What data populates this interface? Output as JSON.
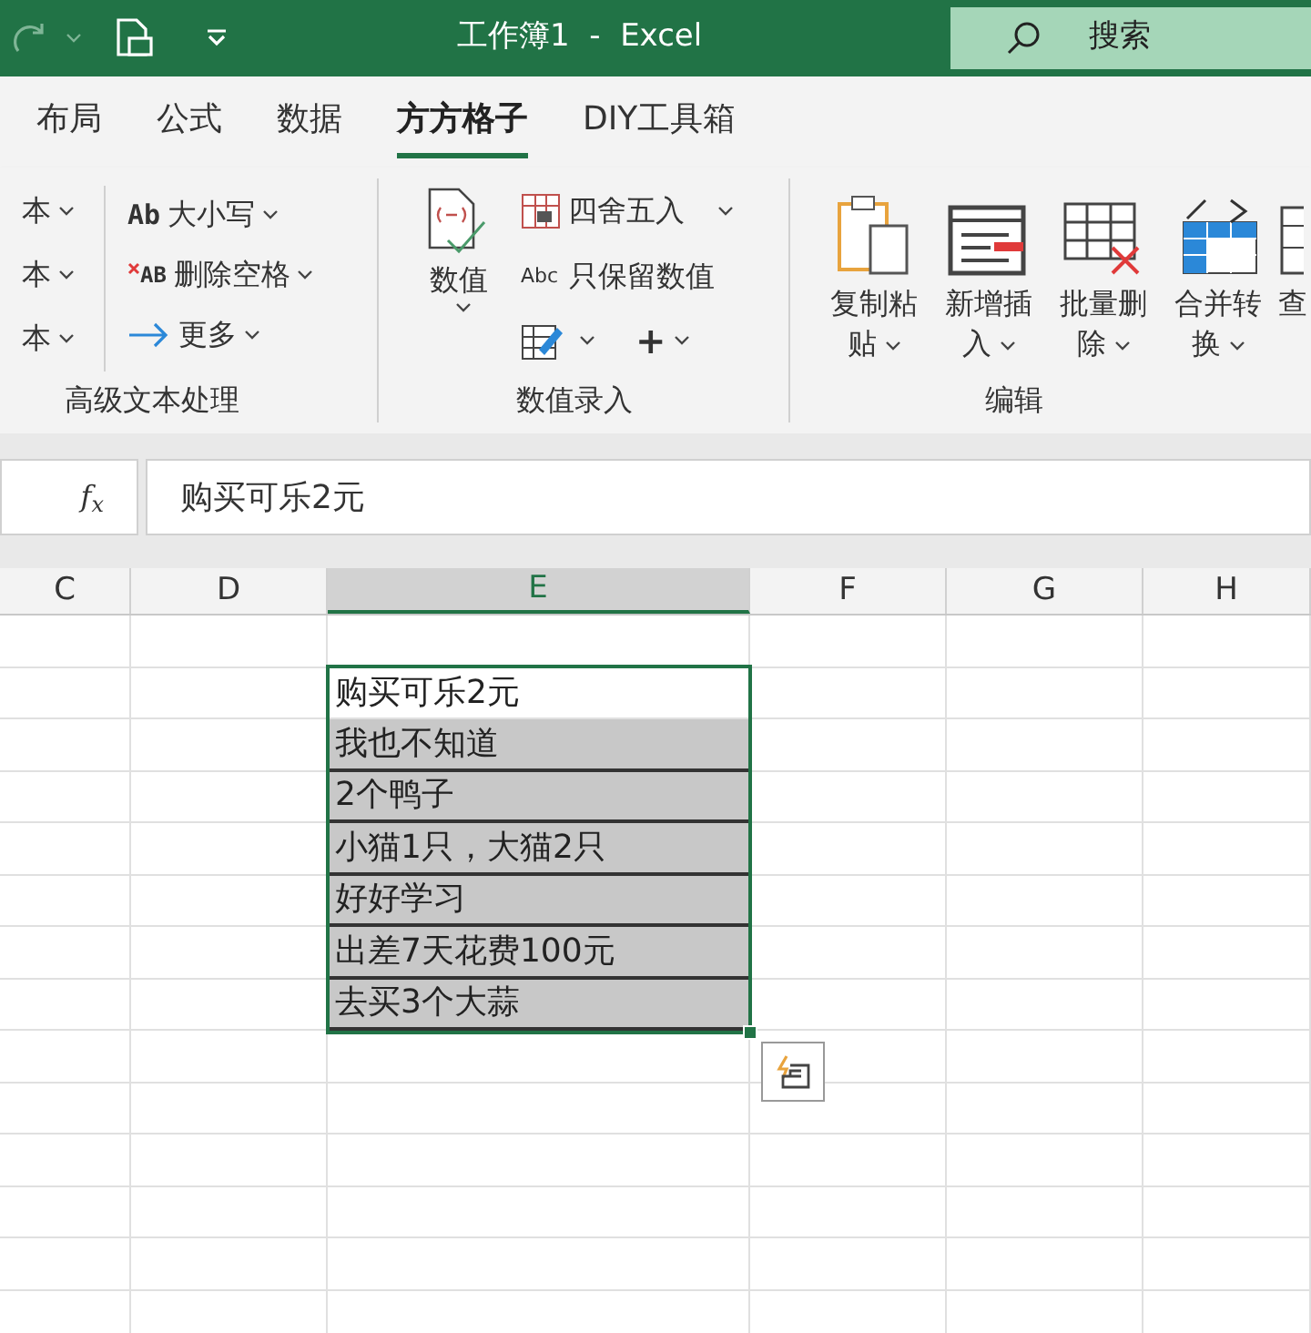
{
  "title_bar": {
    "title": "工作簿1  -  Excel",
    "search_placeholder": "搜索"
  },
  "tabs": [
    {
      "label": "布局",
      "selected": false
    },
    {
      "label": "公式",
      "selected": false
    },
    {
      "label": "数据",
      "selected": false
    },
    {
      "label": "方方格子",
      "selected": true
    },
    {
      "label": "DIY工具箱",
      "selected": false
    }
  ],
  "ribbon": {
    "text_group": {
      "label": "高级文本处理",
      "left_items": [
        "本",
        "本",
        "本"
      ],
      "items": [
        {
          "kind": "case",
          "glyph": "Ab",
          "label": "大小写"
        },
        {
          "kind": "trim",
          "glyph": "AB",
          "label": "删除空格"
        },
        {
          "kind": "more",
          "label": "更多"
        }
      ]
    },
    "number_group": {
      "label": "数值录入",
      "big_button": "数值",
      "items": [
        {
          "kind": "round",
          "label": "四舍五入"
        },
        {
          "kind": "keep",
          "glyph": "Abc",
          "label": "只保留数值"
        },
        {
          "kind": "tools",
          "glyph": "+"
        }
      ]
    },
    "edit_group": {
      "label": "编辑",
      "buttons": [
        {
          "kind": "paste",
          "label": "复制粘贴"
        },
        {
          "kind": "insert",
          "label": "新增插入"
        },
        {
          "kind": "delete",
          "label": "批量删除"
        },
        {
          "kind": "merge",
          "label": "合并转换"
        },
        {
          "kind": "cut",
          "label": "查"
        }
      ]
    }
  },
  "formula_bar": {
    "fx": "f$_{x}$",
    "value": "购买可乐2元"
  },
  "columns": [
    {
      "label": "C",
      "selected": false
    },
    {
      "label": "D",
      "selected": false
    },
    {
      "label": "E",
      "selected": true
    },
    {
      "label": "F",
      "selected": false
    },
    {
      "label": "G",
      "selected": false
    },
    {
      "label": "H",
      "selected": false
    }
  ],
  "cells": [
    {
      "text": "购买可乐2元",
      "active": true
    },
    {
      "text": "我也不知道",
      "active": false
    },
    {
      "text": "2个鸭子",
      "active": false
    },
    {
      "text": "小猫1只，大猫2只",
      "active": false
    },
    {
      "text": "好好学习",
      "active": false
    },
    {
      "text": "出差7天花费100元",
      "active": false
    },
    {
      "text": "去买3个大蒜",
      "active": false
    }
  ]
}
